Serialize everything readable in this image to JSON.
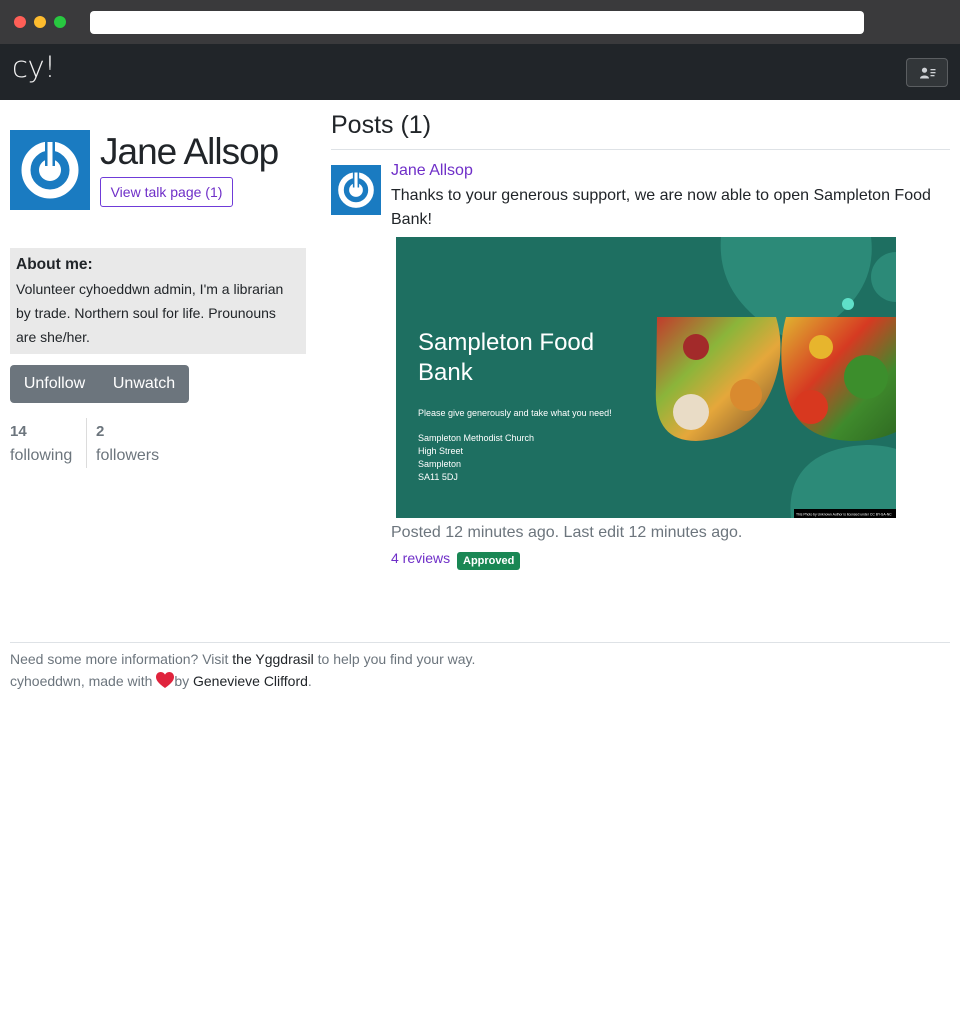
{
  "navbar": {
    "brand": "cy!",
    "menu_icon": "user-list-icon"
  },
  "profile": {
    "name": "Jane Allsop",
    "talk_button": "View talk page (1)",
    "about_title": "About me:",
    "about_text": "Volunteer cyhoeddwn admin, I'm a librarian by trade. Northern soul for life. Prounouns are she/her.",
    "unfollow_label": "Unfollow",
    "unwatch_label": "Unwatch",
    "following_count": "14",
    "following_label": "following",
    "followers_count": "2",
    "followers_label": "followers",
    "avatar_icon": "power-icon"
  },
  "posts": {
    "heading": "Posts (1)",
    "items": [
      {
        "author": "Jane Allsop",
        "text": "Thanks to your generous support, we are now able to open Sampleton Food Bank!",
        "image": {
          "title_line1": "Sampleton Food",
          "title_line2": "Bank",
          "tagline": "Please give generously and take what you need!",
          "address": [
            "Sampleton Methodist Church",
            "High Street",
            "Sampleton",
            "SA11 5DJ"
          ],
          "credit": "This Photo by Unknown Author is licensed under CC BY-SA-NC"
        },
        "meta": "Posted 12 minutes ago. Last edit 12 minutes ago.",
        "reviews": "4 reviews",
        "status": "Approved"
      }
    ]
  },
  "footer": {
    "line1_prefix": "Need some more information? Visit ",
    "line1_link": "the Yggdrasil",
    "line1_suffix": " to help you find your way.",
    "line2_prefix": "cyhoeddwn, made with ",
    "line2_by": "by ",
    "line2_author": "Genevieve Clifford",
    "line2_suffix": "."
  },
  "colors": {
    "navbar": "#212529",
    "link": "#6f2fc8",
    "button_secondary": "#6c757d",
    "badge_success": "#198754",
    "avatar": "#1a7bc1",
    "flyer_bg": "#1e6f61"
  }
}
